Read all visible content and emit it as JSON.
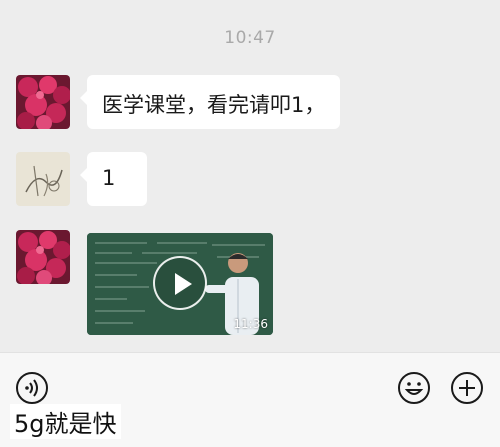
{
  "chat": {
    "timestamp": "10:47",
    "messages": [
      {
        "type": "text",
        "text": "医学课堂，看完请叩1，",
        "avatar": "red-flowers-avatar"
      },
      {
        "type": "text",
        "text": "1",
        "avatar": "sketch-avatar"
      },
      {
        "type": "video",
        "duration": "11:36",
        "avatar": "red-flowers-avatar"
      }
    ]
  },
  "input_bar": {
    "icons": [
      "voice-icon",
      "emoji-icon",
      "plus-icon"
    ]
  },
  "caption": "5g就是快",
  "colors": {
    "background": "#ededed",
    "bubble": "#ffffff",
    "timestamp": "#a9a9a9",
    "chalkboard": "#2f5a46"
  }
}
